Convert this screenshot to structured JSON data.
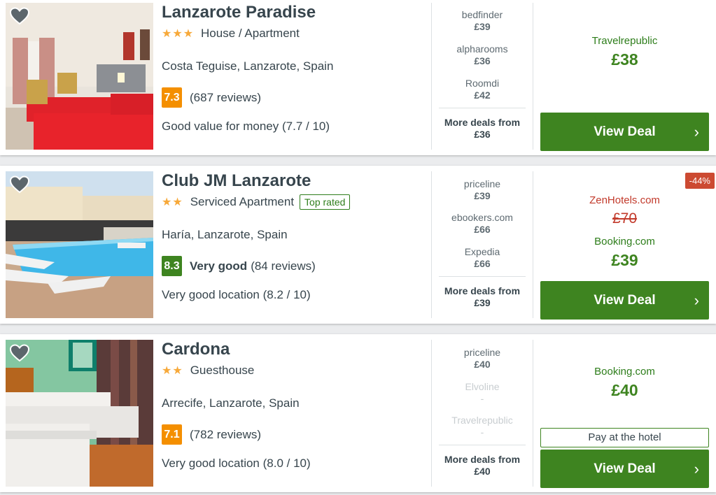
{
  "colors": {
    "accent": "#3e8420",
    "star": "#f7a93a",
    "score_orange": "#f48f00",
    "score_green": "#3e8420",
    "discount_red": "#cc4a32"
  },
  "hotels": [
    {
      "name": "Lanzarote Paradise",
      "stars": "★★★",
      "type": "House / Apartment",
      "location": "Costa Teguise, Lanzarote, Spain",
      "score": "7.3",
      "rating_word": "",
      "reviews": "(687 reviews)",
      "summary": "Good value for money (7.7 / 10)",
      "deals": [
        {
          "provider": "bedfinder",
          "price": "£39"
        },
        {
          "provider": "alpharooms",
          "price": "£36"
        },
        {
          "provider": "Roomdi",
          "price": "£42"
        }
      ],
      "more_label": "More deals from",
      "more_price": "£36",
      "best_partner": "Travelrepublic",
      "best_price": "£38",
      "cta": "View Deal"
    },
    {
      "name": "Club JM Lanzarote",
      "stars": "★★",
      "type": "Serviced Apartment",
      "badge": "Top rated",
      "location": "Haría, Lanzarote, Spain",
      "score": "8.3",
      "rating_word": "Very good",
      "reviews": "(84 reviews)",
      "summary": "Very good location (8.2 / 10)",
      "deals": [
        {
          "provider": "priceline",
          "price": "£39"
        },
        {
          "provider": "ebookers.com",
          "price": "£66"
        },
        {
          "provider": "Expedia",
          "price": "£66"
        }
      ],
      "more_label": "More deals from",
      "more_price": "£39",
      "discount": "-44%",
      "old_partner": "ZenHotels.com",
      "old_price": "£70",
      "best_partner": "Booking.com",
      "best_price": "£39",
      "cta": "View Deal"
    },
    {
      "name": "Cardona",
      "stars": "★★",
      "type": "Guesthouse",
      "location": "Arrecife, Lanzarote, Spain",
      "score": "7.1",
      "rating_word": "",
      "reviews": "(782 reviews)",
      "summary": "Very good location (8.0 / 10)",
      "deals": [
        {
          "provider": "priceline",
          "price": "£40"
        },
        {
          "provider": "Elvoline",
          "price": "-"
        },
        {
          "provider": "Travelrepublic",
          "price": "-"
        }
      ],
      "more_label": "More deals from",
      "more_price": "£40",
      "best_partner": "Booking.com",
      "best_price": "£40",
      "pay_at_hotel": "Pay at the hotel",
      "cta": "View Deal"
    }
  ]
}
